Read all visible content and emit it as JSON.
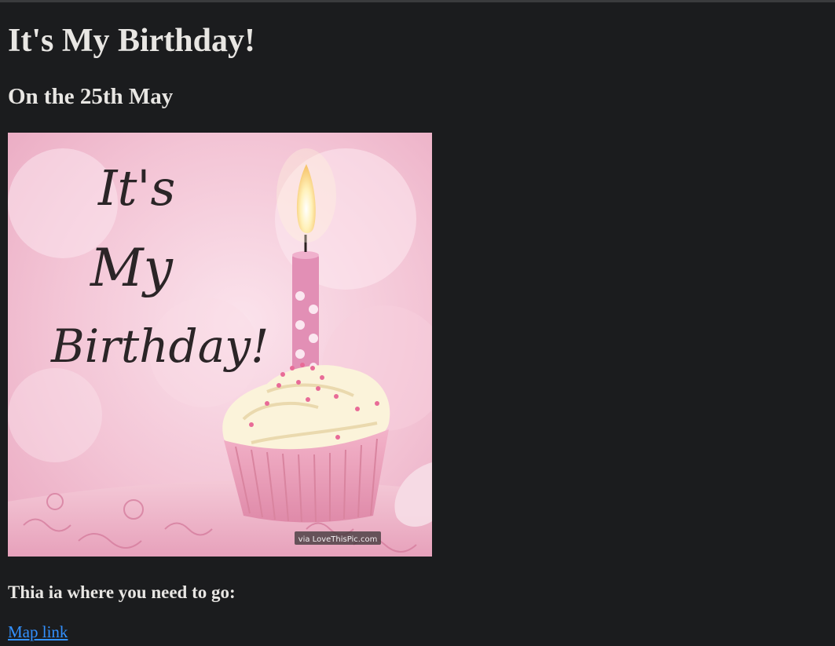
{
  "page": {
    "title": "It's My Birthday!",
    "subtitle": "On the 25th May",
    "directions_text": "Thia ia where you need to go:",
    "map_link_label": "Map link"
  },
  "card_image": {
    "script_lines": [
      "It's",
      "My",
      "Birthday!"
    ],
    "watermark": "via LoveThisPic.com",
    "colors": {
      "background": "#f0b9cc",
      "liner": "#ec9eb8",
      "frosting": "#fbf4dd",
      "candle": "#e58fb6",
      "flame": "#fff4c7"
    }
  },
  "colors": {
    "page_background": "#1b1c1e",
    "text": "#e8e6e3",
    "link": "#3391ff"
  }
}
